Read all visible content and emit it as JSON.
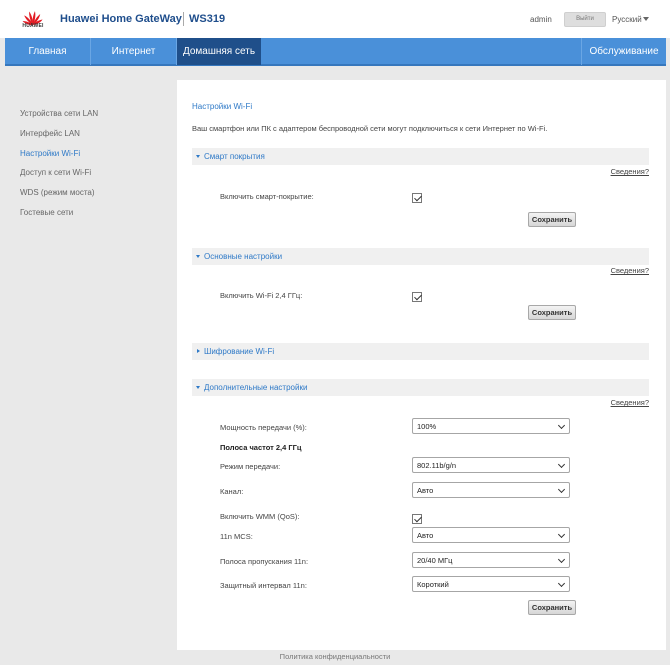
{
  "header": {
    "logo_text": "HUAWEI",
    "product": "Huawei Home GateWay",
    "model": "WS319",
    "user": "admin",
    "logout": "Выйти",
    "language": "Русский"
  },
  "nav": {
    "items": [
      "Главная",
      "Интернет",
      "Домашняя сеть"
    ],
    "right": "Обслуживание",
    "active_index": 2
  },
  "sidebar": {
    "items": [
      "Устройства сети LAN",
      "Интерфейс LAN",
      "Настройки Wi-Fi",
      "Доступ к сети Wi-Fi",
      "WDS (режим моста)",
      "Гостевые сети"
    ],
    "active_index": 2
  },
  "main": {
    "title": "Настройки Wi-Fi",
    "description": "Ваш смартфон или ПК с адаптером беспроводной сети могут подключиться к сети Интернет по Wi-Fi.",
    "details_link": "Сведения?",
    "save_label": "Сохранить",
    "smart": {
      "title": "Смарт покрытия",
      "enable_label": "Включить смарт-покрытие:",
      "enabled": true
    },
    "basic": {
      "title": "Основные настройки",
      "enable_label": "Включить Wi-Fi 2,4 ГГц:",
      "enabled": true
    },
    "encryption": {
      "title": "Шифрование Wi-Fi"
    },
    "advanced": {
      "title": "Дополнительные настройки",
      "power_label": "Мощность передачи (%):",
      "power_value": "100%",
      "band_heading": "Полоса частот 2,4 ГГц",
      "mode_label": "Режим передачи:",
      "mode_value": "802.11b/g/n",
      "channel_label": "Канал:",
      "channel_value": "Авто",
      "wmm_label": "Включить WMM (QoS):",
      "wmm_enabled": true,
      "mcs_label": "11n MCS:",
      "mcs_value": "Авто",
      "bandwidth_label": "Полоса пропускания 11n:",
      "bandwidth_value": "20/40 МГц",
      "guard_label": "Защитный интервал 11n:",
      "guard_value": "Короткий"
    }
  },
  "footer": {
    "privacy": "Политика конфиденциальности"
  },
  "colors": {
    "nav_bg": "#4a90d9",
    "nav_active": "#1f4f8a",
    "accent": "#2e79c7",
    "brand_red": "#e21b23"
  }
}
